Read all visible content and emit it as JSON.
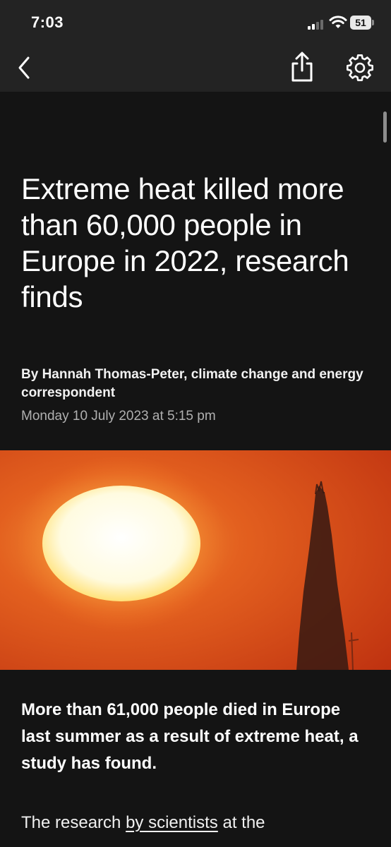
{
  "status_bar": {
    "time": "7:03",
    "battery_level": "51",
    "signal_bars_active": 2,
    "signal_bars_total": 4,
    "icons": [
      "signal-icon",
      "wifi-icon",
      "battery-icon"
    ]
  },
  "nav": {
    "icons": [
      "back-icon",
      "share-icon",
      "gear-icon"
    ]
  },
  "article": {
    "headline": "Extreme heat killed more than 60,000 people in Europe in 2022, research finds",
    "byline": "By Hannah Thomas-Peter, climate change and energy correspondent",
    "date": "Monday 10 July 2023 at 5:15 pm",
    "lead": "More than 61,000 people died in Europe last summer as a result of extreme heat, a study has found.",
    "body_start": "The research ",
    "body_link": "by scientists",
    "body_rest": " at the"
  },
  "colors": {
    "background": "#141414",
    "bars": "#232323",
    "text": "#ffffff",
    "muted_text": "#b0b0b0",
    "sky": "#d6481a"
  }
}
